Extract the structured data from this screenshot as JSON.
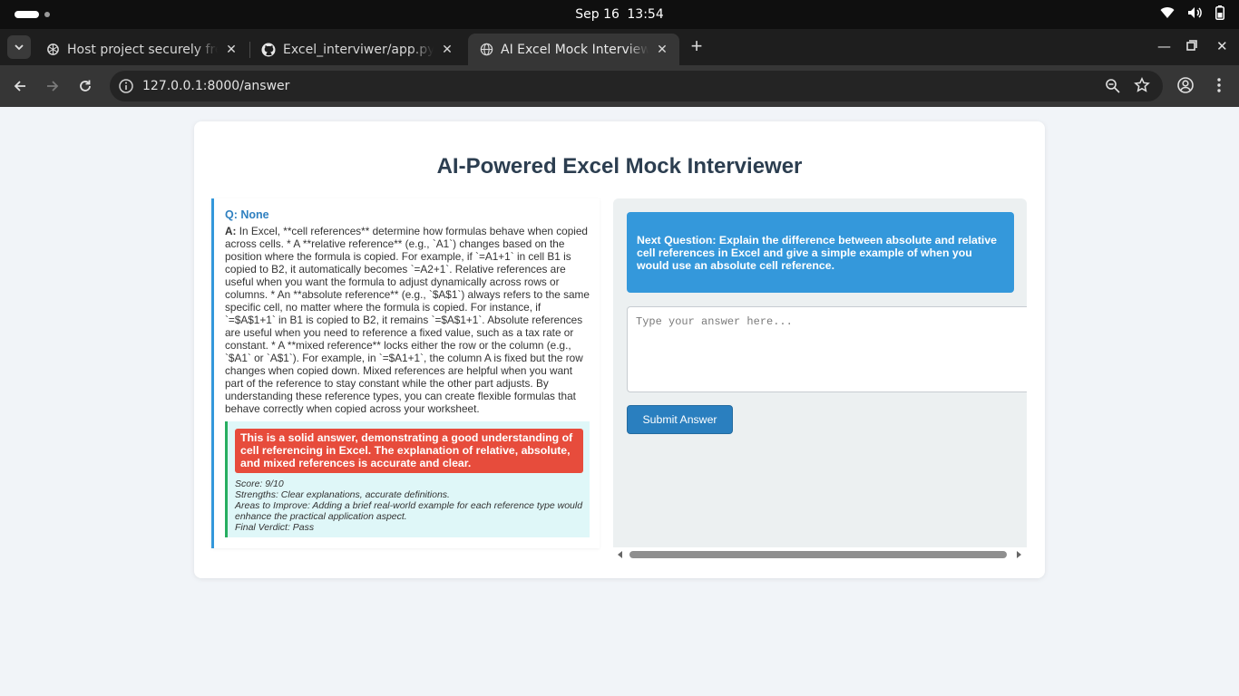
{
  "system": {
    "date": "Sep 16",
    "time": "13:54",
    "icons": [
      "wifi-icon",
      "volume-icon",
      "battery-icon"
    ]
  },
  "browser": {
    "tabs": [
      {
        "title": "Host project securely free",
        "favicon": "openai-icon",
        "active": false
      },
      {
        "title": "Excel_interviwer/app.py",
        "favicon": "github-icon",
        "active": false
      },
      {
        "title": "AI Excel Mock Interviewer",
        "favicon": "globe-icon",
        "active": true
      }
    ],
    "url": "127.0.0.1:8000/answer"
  },
  "page": {
    "title": "AI-Powered Excel Mock Interviewer",
    "qa": {
      "q_label": "Q: None",
      "a_prefix": "A:",
      "answer": "In Excel, **cell references** determine how formulas behave when copied across cells. * A **relative reference** (e.g., `A1`) changes based on the position where the formula is copied. For example, if `=A1+1` in cell B1 is copied to B2, it automatically becomes `=A2+1`. Relative references are useful when you want the formula to adjust dynamically across rows or columns. * An **absolute reference** (e.g., `$A$1`) always refers to the same specific cell, no matter where the formula is copied. For instance, if `=$A$1+1` in B1 is copied to B2, it remains `=$A$1+1`. Absolute references are useful when you need to reference a fixed value, such as a tax rate or constant. * A **mixed reference** locks either the row or the column (e.g., `$A1` or `A$1`). For example, in `=$A1+1`, the column A is fixed but the row changes when copied down. Mixed references are helpful when you want part of the reference to stay constant while the other part adjusts. By understanding these reference types, you can create flexible formulas that behave correctly when copied across your worksheet."
    },
    "feedback": {
      "summary": "This is a solid answer, demonstrating a good understanding of cell referencing in Excel. The explanation of relative, absolute, and mixed references is accurate and clear.",
      "score": "Score: 9/10",
      "strengths": "Strengths: Clear explanations, accurate definitions.",
      "improve": "Areas to Improve: Adding a brief real-world example for each reference type would enhance the practical application aspect.",
      "verdict": "Final Verdict: Pass"
    },
    "next_question": "Next Question: Explain the difference between absolute and relative cell references in Excel and give a simple example of when you would use an absolute cell reference.",
    "answer_placeholder": "Type your answer here...",
    "submit_label": "Submit Answer"
  },
  "colors": {
    "primary": "#3498db",
    "feedback_summary": "#e74c3c",
    "feedback_border": "#27ae60",
    "feedback_bg": "#dff7f8",
    "title": "#2c3e50"
  }
}
